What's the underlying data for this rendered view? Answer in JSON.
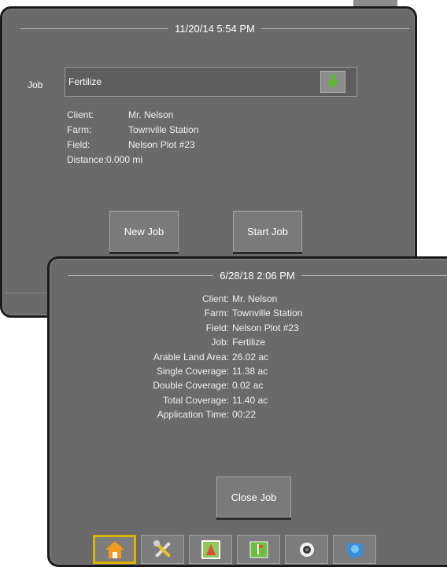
{
  "job_screen": {
    "datetime": "11/20/14 5:54 PM",
    "job_label": "Job",
    "job_value": "Fertilize",
    "details": [
      {
        "key": "Client:",
        "value": "Mr. Nelson"
      },
      {
        "key": "Farm:",
        "value": "Townville Station"
      },
      {
        "key": "Field:",
        "value": "Nelson Plot #23"
      },
      {
        "key": "Distance:",
        "value": "0.000 mi"
      }
    ],
    "new_job_label": "New Job",
    "start_job_label": "Start Job"
  },
  "summary_screen": {
    "datetime": "6/28/18 2:06 PM",
    "rows": [
      {
        "key": "Client:",
        "value": "Mr. Nelson"
      },
      {
        "key": "Farm:",
        "value": "Townville Station"
      },
      {
        "key": "Field:",
        "value": "Nelson Plot #23"
      },
      {
        "key": "Job:",
        "value": "Fertilize"
      },
      {
        "key": "Arable Land Area:",
        "value": "26.02 ac"
      },
      {
        "key": "Single Coverage:",
        "value": "11.38 ac"
      },
      {
        "key": "Double Coverage:",
        "value": "0.02 ac"
      },
      {
        "key": "Total Coverage:",
        "value": "11.40 ac"
      },
      {
        "key": "Application Time:",
        "value": "00:22"
      }
    ],
    "close_job_label": "Close Job"
  },
  "toolbar": {
    "items": [
      {
        "icon": "home-icon",
        "active": true
      },
      {
        "icon": "tools-icon",
        "active": false
      },
      {
        "icon": "field-map-icon",
        "active": false
      },
      {
        "icon": "flag-map-icon",
        "active": false
      },
      {
        "icon": "camera-icon",
        "active": false
      },
      {
        "icon": "data-transfer-icon",
        "active": false
      }
    ]
  },
  "colors": {
    "panel_bg": "#6a6a6a",
    "active_tab_border": "#d9b400",
    "accent_green": "#5cb82e"
  }
}
